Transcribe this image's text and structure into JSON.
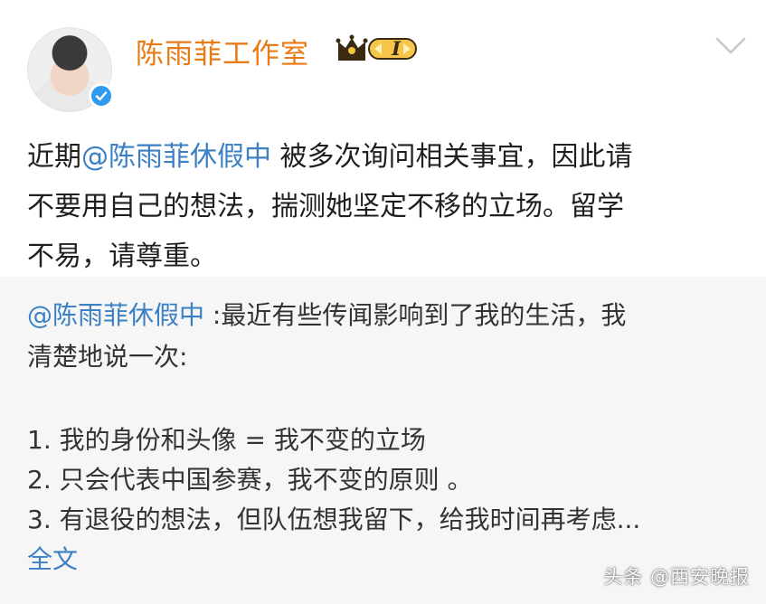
{
  "header": {
    "account_name": "陈雨菲工作室",
    "rank_label": "I",
    "avatar_icon": "avatar-photo",
    "verified_icon": "verified-check-icon"
  },
  "post": {
    "prefix": "近期",
    "mention": "@陈雨菲休假中",
    "line1_rest": " 被多次询问相关事宜，因此请",
    "line2": "不要用自己的想法，揣测她坚定不移的立场。留学",
    "line3": "不易，请尊重。"
  },
  "repost": {
    "mention": "@陈雨菲休假中",
    "line1_rest": " :最近有些传闻影响到了我的生活，我",
    "line2": "清楚地说一次:",
    "items": [
      "1. 我的身份和头像 = 我不变的立场",
      "2. 只会代表中国参赛，我不变的原则 。",
      "3. 有退役的想法，但队伍想我留下，给我时间再考虑..."
    ],
    "full_text_link": "全文"
  },
  "watermark": "头条 @西安晚报",
  "colors": {
    "name": "#e87b16",
    "link": "#3b7fc4",
    "verified": "#2f9bf0",
    "repost_bg": "#f6f6f6"
  }
}
